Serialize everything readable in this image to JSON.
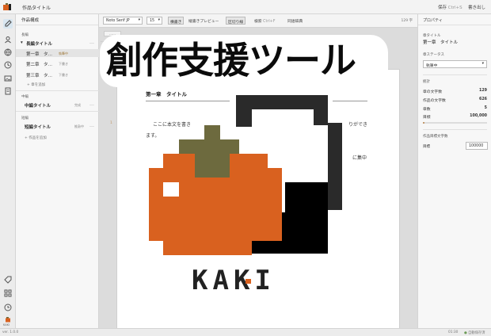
{
  "app": {
    "title": "作品タイトル",
    "save": "保存",
    "save_shortcut": "Ctrl+S",
    "export": "書き出し"
  },
  "sidebar": {
    "header": "作品構成",
    "sections": [
      {
        "label": "長編",
        "work": "長編タイトル",
        "chapters": [
          {
            "title": "第一章　タ…",
            "status": "執筆中"
          },
          {
            "title": "第二章　タ…",
            "status": "下書き"
          },
          {
            "title": "第三章　タ…",
            "status": "下書き"
          }
        ],
        "add": "+ 章を追加"
      },
      {
        "label": "中編",
        "work": "中編タイトル",
        "status": "完成"
      },
      {
        "label": "短編",
        "work": "短編タイトル",
        "status": "推敲中",
        "add": "+ 作品を追加"
      }
    ],
    "logo_text": "KAKI"
  },
  "toolbar": {
    "font": "Noto Serif JP",
    "size": "15",
    "mode_vertical": "横書き",
    "vertical_preview": "縦書きプレビュー",
    "break_mode": "区切り線",
    "search": "検索",
    "search_shortcut": "Ctrl+F",
    "thesaurus": "同語辞典",
    "char_count": "129 字"
  },
  "editor": {
    "chapter_title": "第一章　タイトル",
    "lines": [
      "ここに本文を書き",
      "ます。"
    ],
    "line_right": "りができ",
    "line_right2": "に集中",
    "line_number": "1"
  },
  "properties": {
    "header": "プロパティ",
    "chapter_label": "章タイトル",
    "chapter_value": "第一章　タイトル",
    "status_label": "章ステータス",
    "status_value": "執筆中",
    "stats_label": "統計",
    "stats": [
      {
        "k": "章の文字数",
        "v": "129"
      },
      {
        "k": "作品の文字数",
        "v": "626"
      },
      {
        "k": "章数",
        "v": "5"
      },
      {
        "k": "目標",
        "v": "100,000"
      }
    ],
    "goal_label": "作品目標文字数",
    "goal_key": "目標",
    "goal_value": "100000"
  },
  "statusbar": {
    "version": "ver. 1.0.0",
    "time": "01:30",
    "autosave": "自動保存済"
  },
  "overlay": {
    "title": "創作支援ツール",
    "logo": "KAKI"
  },
  "colors": {
    "persimmon": "#d9611f",
    "stem": "#6d6a3e",
    "accent": "#c39a6c"
  }
}
